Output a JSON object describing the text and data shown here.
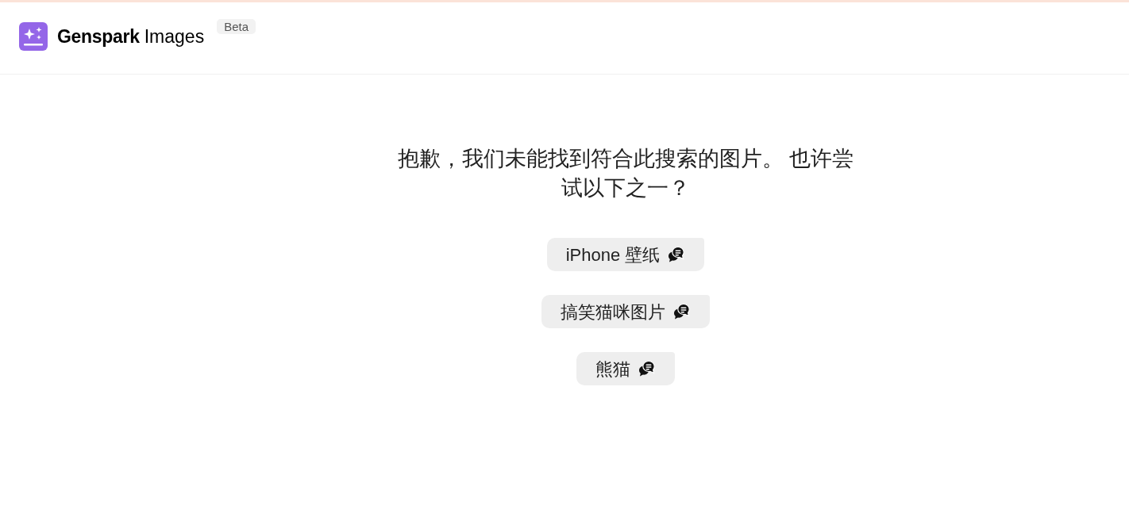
{
  "header": {
    "brand": "Genspark",
    "product": "Images",
    "badge": "Beta"
  },
  "message": "抱歉，我们未能找到符合此搜索的图片。 也许尝试以下之一？",
  "suggestions": [
    {
      "label": "iPhone 壁纸"
    },
    {
      "label": "搞笑猫咪图片"
    },
    {
      "label": "熊猫"
    }
  ]
}
